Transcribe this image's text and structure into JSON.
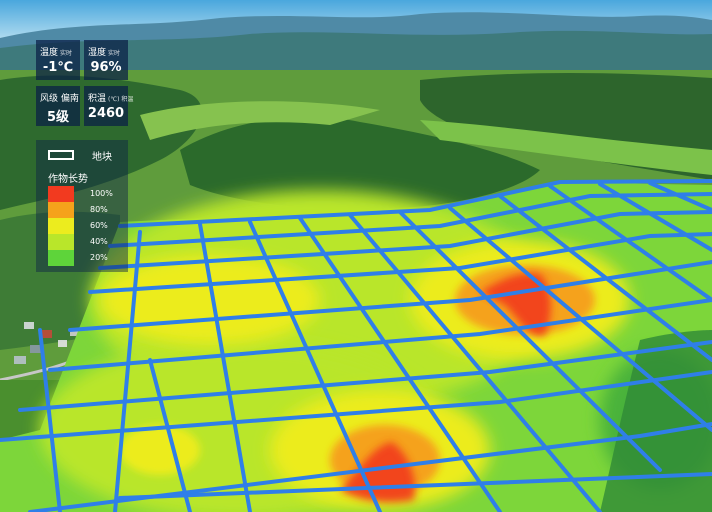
{
  "weather": {
    "temperature": {
      "label": "温度",
      "sub": "实时",
      "value": "-1℃"
    },
    "humidity": {
      "label": "湿度",
      "sub": "实时",
      "value": "96%"
    },
    "wind": {
      "label": "风级 偏南",
      "sub": "",
      "value": "5级"
    },
    "accumulated": {
      "label": "积温",
      "sub": "(℃) 积温",
      "value": "2460"
    }
  },
  "legend": {
    "plot_label": "地块",
    "title": "作物长势",
    "items": [
      {
        "label": "100%",
        "color": "#f23a1f"
      },
      {
        "label": "80%",
        "color": "#f5a21b"
      },
      {
        "label": "60%",
        "color": "#ecec1e"
      },
      {
        "label": "40%",
        "color": "#b9e62a"
      },
      {
        "label": "20%",
        "color": "#5ed43a"
      }
    ]
  },
  "colors": {
    "grid_line": "#2f7fe8",
    "sky": "#66b6e4",
    "mountain": "#3c6e87",
    "forest": "#2f6b2a"
  }
}
